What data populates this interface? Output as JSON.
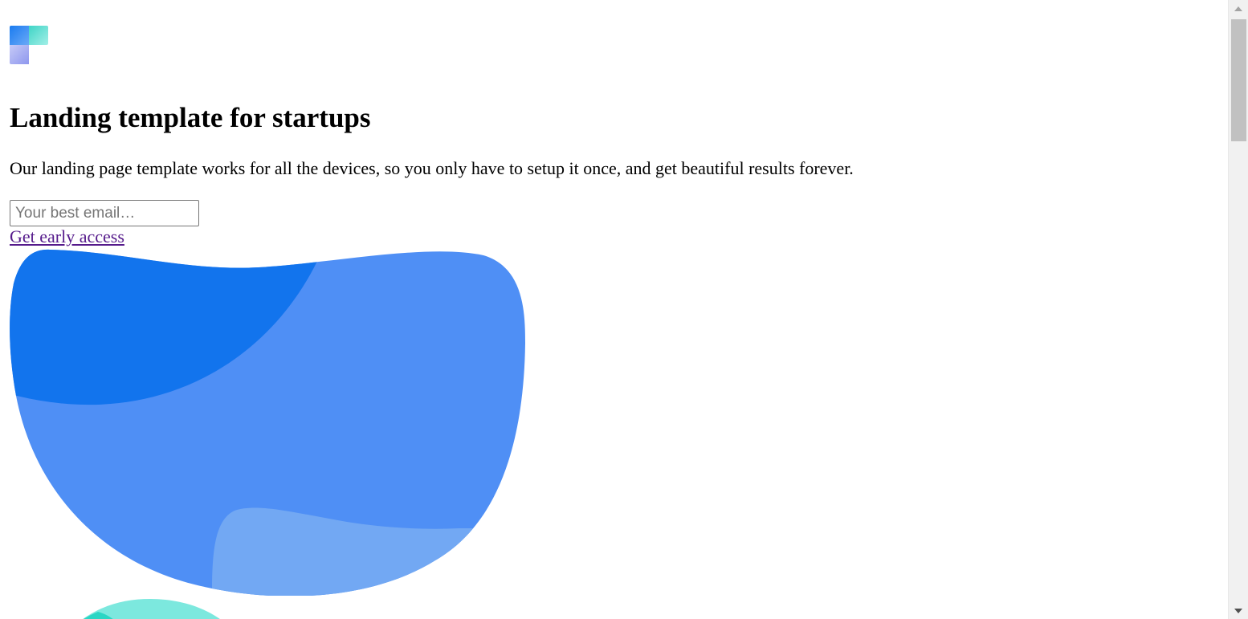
{
  "page": {
    "logo_icon": "brand-logo-icon",
    "title": "Landing template for startups",
    "subtitle": "Our landing page template works for all the devices, so you only have to setup it once, and get beautiful results forever.",
    "email_placeholder": "Your best email…",
    "cta_label": "Get early access",
    "hero_illustration": "hero-blob-illustration"
  },
  "colors": {
    "blob_dark": "#1274ED",
    "blob_mid": "#4F8FF5",
    "blob_light": "#72A8F3",
    "teal": "#7CE8DE",
    "teal_dark": "#2BD6C4",
    "link_visited": "#551A8B"
  },
  "scrollbar": {
    "up_icon": "scroll-up-arrow-icon",
    "down_icon": "scroll-down-arrow-icon"
  }
}
